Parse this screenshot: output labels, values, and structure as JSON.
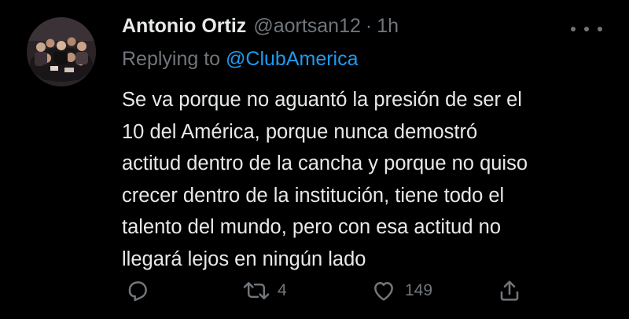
{
  "tweet": {
    "author_name": "Antonio Ortiz",
    "handle": "@aortsan12",
    "separator": "·",
    "time": "1h",
    "replying_prefix": "Replying to",
    "replying_mention": "@ClubAmerica",
    "body_lines": [
      "Se va porque no aguantó la presión de ser el",
      "10 del América, porque nunca demostró",
      "actitud dentro de la cancha y porque no quiso",
      "crecer dentro de la institución, tiene todo el",
      "talento del mundo, pero con esa actitud no",
      "llegará lejos en ningún lado"
    ]
  },
  "actions": {
    "reply_icon": "reply-icon",
    "retweet_icon": "retweet-icon",
    "retweet_count": "4",
    "like_icon": "heart-icon",
    "like_count": "149",
    "share_icon": "share-icon"
  },
  "colors": {
    "background": "#000000",
    "primary_text": "#e7e9ea",
    "secondary_text": "#71767b",
    "accent": "#1d9bf0"
  }
}
